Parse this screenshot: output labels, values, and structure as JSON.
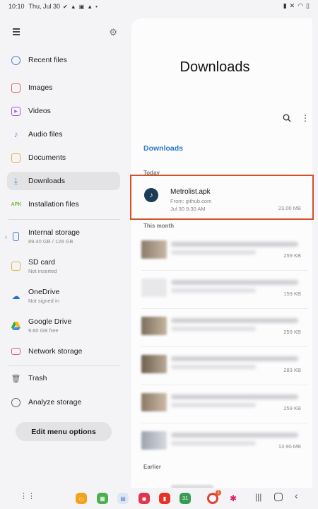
{
  "status_bar": {
    "time": "10:10",
    "date": "Thu, Jul 30",
    "left_icons": [
      "check-icon",
      "warning-icon",
      "image-off-icon",
      "warning-icon",
      "dot-icon"
    ],
    "right_icons": [
      "battery-saver-icon",
      "mute-icon",
      "wifi-icon",
      "battery-icon"
    ]
  },
  "sidebar": {
    "items": [
      {
        "label": "Recent files",
        "icon": "clock-icon",
        "color": "#5a7bd9"
      },
      {
        "label": "Images",
        "icon": "image-icon",
        "color": "#e0665a"
      },
      {
        "label": "Videos",
        "icon": "video-icon",
        "color": "#9b5de5"
      },
      {
        "label": "Audio files",
        "icon": "music-icon",
        "color": "#4a90e2"
      },
      {
        "label": "Documents",
        "icon": "document-icon",
        "color": "#e8b04a"
      },
      {
        "label": "Downloads",
        "icon": "download-icon",
        "color": "#3a95c9"
      },
      {
        "label": "Installation files",
        "icon": "apk-icon",
        "color": "#6cbf3a"
      },
      {
        "label": "Internal storage",
        "sub": "89.40 GB / 128 GB",
        "icon": "phone-icon",
        "color": "#3f7fd6"
      },
      {
        "label": "SD card",
        "sub": "Not inserted",
        "icon": "sdcard-icon",
        "color": "#e3b43b"
      },
      {
        "label": "OneDrive",
        "sub": "Not signed in",
        "icon": "onedrive-icon",
        "color": "#1f6ed4"
      },
      {
        "label": "Google Drive",
        "sub": "9.60 GB free",
        "icon": "google-drive-icon",
        "color": "#34a853"
      },
      {
        "label": "Network storage",
        "icon": "network-icon",
        "color": "#e05a78"
      },
      {
        "label": "Trash",
        "icon": "trash-icon",
        "color": "#666666"
      },
      {
        "label": "Analyze storage",
        "icon": "analyze-icon",
        "color": "#666666"
      }
    ],
    "apk_label": "APK",
    "edit_button": "Edit menu options"
  },
  "main": {
    "title": "Downloads",
    "breadcrumb": "Downloads",
    "sections": {
      "today": "Today",
      "this_month": "This month",
      "earlier": "Earlier"
    },
    "highlight_color": "#d1522a",
    "today_file": {
      "name": "Metrolist.apk",
      "from": "From: github.com",
      "date": "Jul 30 9:30 AM",
      "size": "23.00 MB"
    },
    "month_files": [
      {
        "size": "259 KB"
      },
      {
        "size": "159 KB"
      },
      {
        "size": "259 KB"
      },
      {
        "size": "283 KB"
      },
      {
        "size": "259 KB"
      },
      {
        "size": "13.90 MB"
      }
    ]
  },
  "navbar": {
    "apps": [
      "folder-app",
      "launcher-app",
      "calendar-app",
      "camera-app",
      "flipboard-app",
      "calendar-31-app",
      "chrome-app",
      "slack-app"
    ],
    "calendar_day": "31",
    "chrome_badge": "1"
  }
}
